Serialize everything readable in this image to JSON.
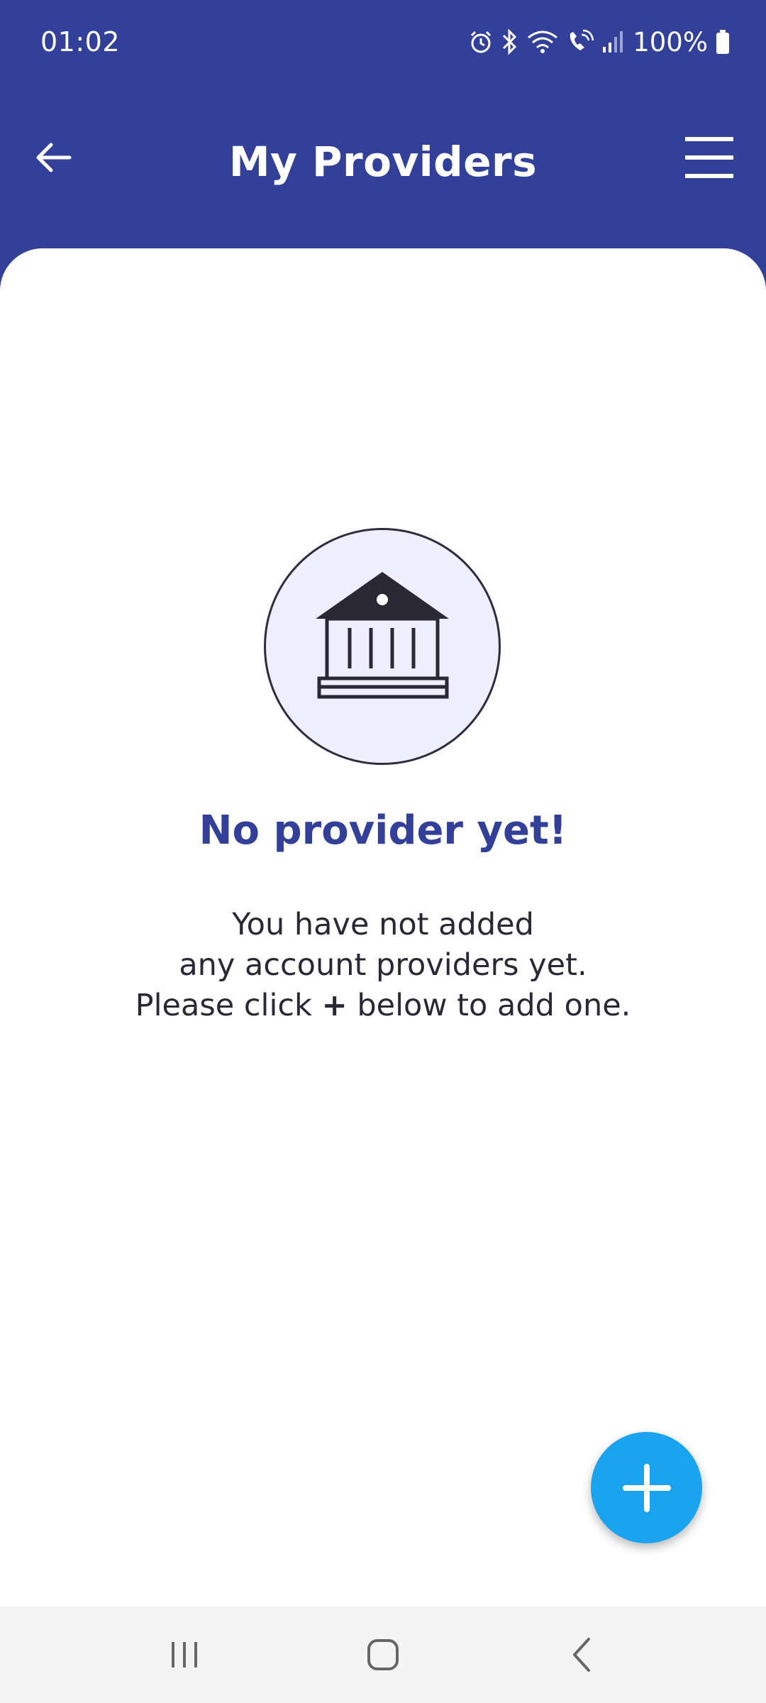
{
  "status_bar": {
    "time": "01:02",
    "battery": "100%",
    "icons": [
      "alarm-icon",
      "bluetooth-icon",
      "wifi-icon",
      "wifi-calling-icon",
      "signal-icon",
      "battery-icon"
    ]
  },
  "header": {
    "title": "My Providers",
    "back_icon": "arrow-left-icon",
    "menu_icon": "hamburger-menu-icon"
  },
  "empty_state": {
    "icon": "bank-icon",
    "title": "No provider yet!",
    "line1": "You have not added",
    "line2": "any account providers yet.",
    "line3_before": "Please click",
    "line3_plus": "+",
    "line3_after": "below to add one."
  },
  "fab": {
    "icon": "plus-icon"
  },
  "nav_bar": {
    "icons": [
      "recent-apps-icon",
      "home-icon",
      "back-icon"
    ]
  },
  "colors": {
    "header_bg": "#33409a",
    "title_accent": "#33409a",
    "fab_bg": "#1aa3ee",
    "illustration_bg": "#efeefc",
    "text_dark": "#2b2836"
  }
}
